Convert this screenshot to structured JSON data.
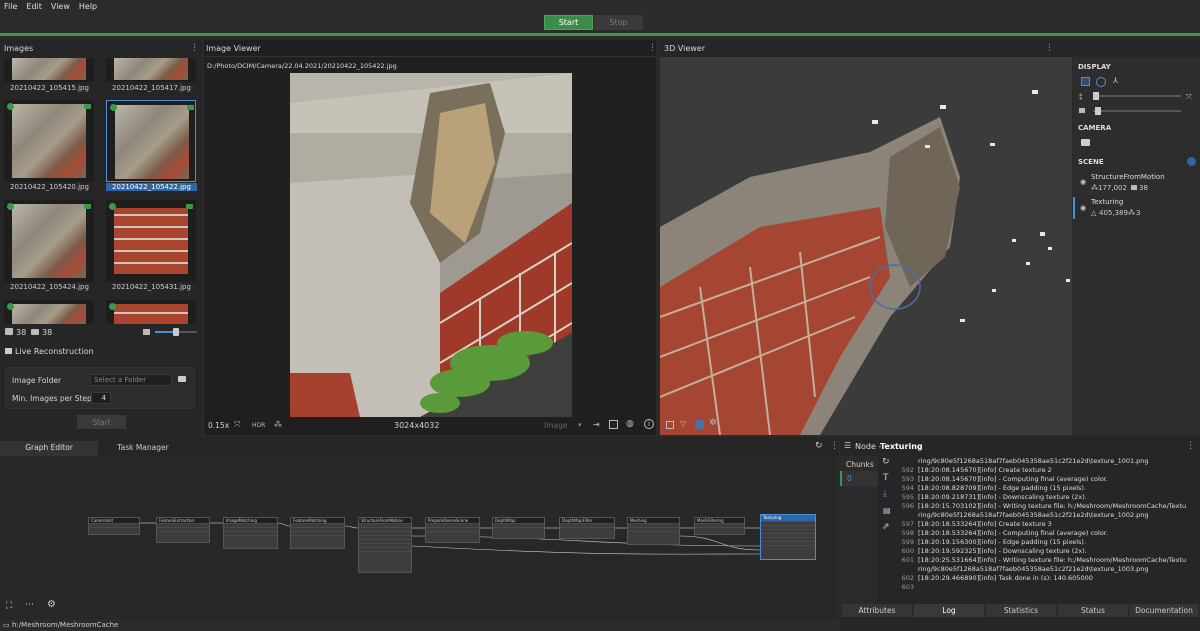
{
  "menu": [
    "File",
    "Edit",
    "View",
    "Help"
  ],
  "run": {
    "start_label": "Start",
    "stop_label": "Stop"
  },
  "images_panel": {
    "title": "Images",
    "thumbnails": [
      "20210422_105415.jpg",
      "20210422_105417.jpg",
      "20210422_105420.jpg",
      "20210422_105422.jpg",
      "20210422_105424.jpg",
      "20210422_105431.jpg"
    ],
    "selected": "20210422_105422.jpg",
    "image_count": "38",
    "camera_count": "38"
  },
  "live_reconstruction": {
    "title": "Live Reconstruction",
    "image_folder_label": "Image Folder",
    "image_folder_placeholder": "Select a Folder",
    "min_images_label": "Min. Images per Step",
    "min_images_value": "4",
    "start_label": "Start"
  },
  "image_viewer": {
    "title": "Image Viewer",
    "path": "D:/Photo/DCIM/Camera/22.04.2021/20210422_105422.jpg",
    "zoom": "0.15x",
    "hdr": "HDR",
    "resolution": "3024x4032",
    "mode": "Image"
  },
  "viewer3d": {
    "title": "3D Viewer",
    "display_label": "DISPLAY",
    "camera_label": "CAMERA",
    "scene_label": "SCENE",
    "scene_items": [
      {
        "name": "StructureFromMotion",
        "points": "177,002",
        "cameras": "38"
      },
      {
        "name": "Texturing",
        "points": "405,389",
        "cameras": "3"
      }
    ]
  },
  "graph_editor": {
    "tabs": [
      "Graph Editor",
      "Task Manager"
    ],
    "nodes": [
      "CameraInit",
      "FeatureExtraction",
      "ImageMatching",
      "FeatureMatching",
      "StructureFromMotion",
      "PrepareDenseScene",
      "DepthMap",
      "DepthMapFilter",
      "Meshing",
      "MeshFiltering",
      "Texturing"
    ]
  },
  "node_panel": {
    "title_prefix": "Node - ",
    "title_node": "Texturing",
    "chunks_label": "Chunks",
    "chunk_value": "0",
    "log": [
      {
        "ln": "",
        "text": "ring/9c80e5f1268a518af7faeb045358ae51c2f21e2d\\texture_1001.png"
      },
      {
        "ln": "592",
        "text": "[18:20:08.145670][info] Create texture 2"
      },
      {
        "ln": "593",
        "text": "[18:20:08.145670][info]  - Computing final (average) color."
      },
      {
        "ln": "594",
        "text": "[18:20:08.828709][info]  - Edge padding (15 pixels)."
      },
      {
        "ln": "595",
        "text": "[18:20:09.218731][info]  - Downscaling texture (2x)."
      },
      {
        "ln": "596",
        "text": "[18:20:15.703102][info]  - Writing texture file: h:/Meshroom/MeshroomCache/Textu"
      },
      {
        "ln": "",
        "text": "ring/9c80e5f1268a518af7faeb045358ae51c2f21e2d\\texture_1002.png"
      },
      {
        "ln": "597",
        "text": "[18:20:18.533264][info] Create texture 3"
      },
      {
        "ln": "598",
        "text": "[18:20:18.533264][info]  - Computing final (average) color."
      },
      {
        "ln": "599",
        "text": "[18:20:19.156300][info]  - Edge padding (15 pixels)."
      },
      {
        "ln": "600",
        "text": "[18:20:19.592325][info]  - Downscaling texture (2x)."
      },
      {
        "ln": "601",
        "text": "[18:20:25.531664][info]  - Writing texture file: h:/Meshroom/MeshroomCache/Textu"
      },
      {
        "ln": "",
        "text": "ring/9c80e5f1268a518af7faeb045358ae51c2f21e2d\\texture_1003.png"
      },
      {
        "ln": "602",
        "text": "[18:20:29.466890][info] Task done in (s): 140.605000"
      },
      {
        "ln": "603",
        "text": ""
      }
    ],
    "bottom_tabs": [
      "Attributes",
      "Log",
      "Statistics",
      "Status",
      "Documentation"
    ]
  },
  "status": {
    "path": "h:/Meshroom/MeshroomCache"
  }
}
